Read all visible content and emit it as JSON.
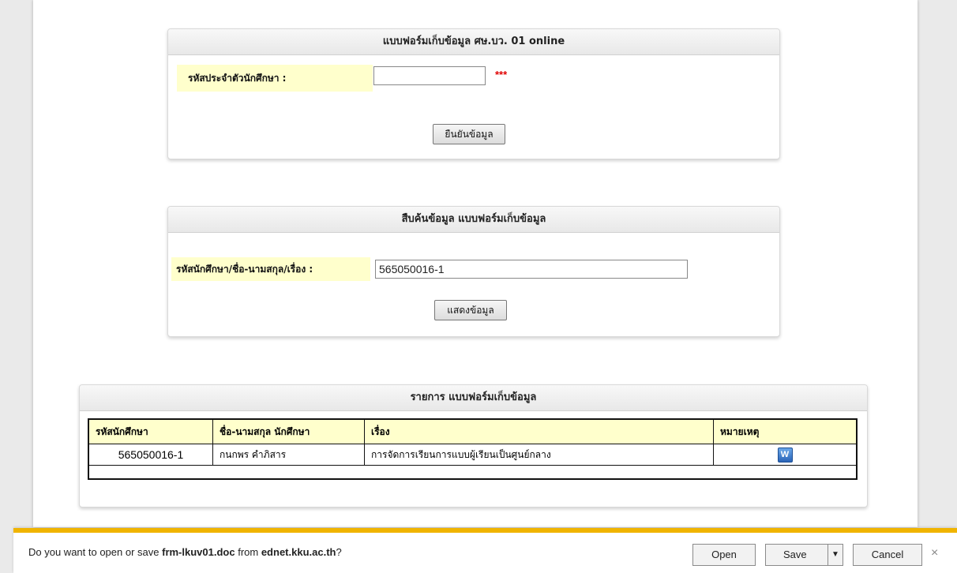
{
  "form_panel": {
    "title": "แบบฟอร์มเก็บข้อมูล ศษ.บว. 01 online",
    "student_id_label": "รหัสประจำตัวนักศึกษา :",
    "student_id_value": "",
    "required_mark": "***",
    "confirm_button": "ยืนยันข้อมูล"
  },
  "search_panel": {
    "title": "สืบค้นข้อมูล แบบฟอร์มเก็บข้อมูล",
    "query_label": "รหัสนักศึกษา/ชื่อ-นามสกุล/เรื่อง :",
    "query_value": "565050016-1",
    "show_button": "แสดงข้อมูล"
  },
  "results_panel": {
    "title": "รายการ แบบฟอร์มเก็บข้อมูล",
    "columns": [
      "รหัสนักศึกษา",
      "ชื่อ-นามสกุล นักศึกษา",
      "เรื่อง",
      "หมายเหตุ"
    ],
    "rows": [
      {
        "student_id": "565050016-1",
        "name": "กนกพร คำภิสาร",
        "topic": "การจัดการเรียนการแบบผู้เรียนเป็นศูนย์กลาง",
        "note_icon": "word-document-icon"
      }
    ]
  },
  "download_bar": {
    "prefix": "Do you want to open or save ",
    "filename": "frm-lkuv01.doc",
    "middle": " from ",
    "host": "ednet.kku.ac.th",
    "suffix": "?",
    "open_label": "Open",
    "save_label": "Save",
    "cancel_label": "Cancel",
    "accent_color": "#f0b400"
  }
}
